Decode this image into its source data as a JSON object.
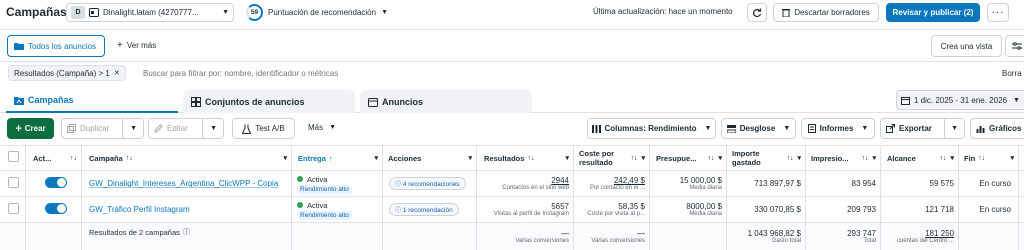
{
  "header": {
    "title": "Campañas",
    "account_initial": "D",
    "account_name": "Dinalight.latam (4270777...",
    "score_value": "59",
    "score_label": "Puntuación de recomendación",
    "last_update": "Última actualización: hace un momento",
    "discard_label": "Descartar borradores",
    "publish_label": "Revisar y publicar (2)",
    "more_label": "···"
  },
  "filterbar": {
    "all_ads_label": "Todos los anuncios",
    "see_more_label": "Ver más",
    "create_view_label": "Crea una vista"
  },
  "searchbar": {
    "chip_label": "Resultados (Campaña) > 1",
    "chip_close": "✕",
    "placeholder": "Buscar para filtrar por: nombre, identificador o métricas",
    "right_label": "Borra"
  },
  "tabs": {
    "campaigns": "Campañas",
    "adsets": "Conjuntos de anuncios",
    "ads": "Anuncios",
    "date_range": "1 dic. 2025 - 31 ene. 2026"
  },
  "toolbar": {
    "create": "Crear",
    "duplicate": "Duplicar",
    "edit": "Editar",
    "abtest": "Test A/B",
    "more": "Más",
    "columns": "Columnas: Rendimiento",
    "breakdown": "Desglose",
    "reports": "Informes",
    "export": "Exportar",
    "charts": "Gráficos"
  },
  "table": {
    "headers": {
      "active": "Act...",
      "campaign": "Campaña",
      "delivery": "Entrega",
      "actions": "Acciones",
      "results": "Resultados",
      "cost_line1": "Coste por",
      "cost_line2": "resultado",
      "budget": "Presupue...",
      "spent_line1": "Importe",
      "spent_line2": "gastado",
      "impressions": "Impresio...",
      "reach": "Alcance",
      "end": "Fin",
      "sort_arrow": "↑",
      "sort_both": "↑↓",
      "menu": "▾"
    },
    "rows": [
      {
        "name": "GW_Dinalight_Intereses_Argentina_ClicWPP - Copia",
        "delivery": "Activa",
        "delivery_badge": "Rendimiento alto",
        "actions": "4 recomendaciones",
        "results": "2944",
        "results_sub": "Contactos en el sitio web",
        "cost": "242,49 $",
        "cost_sub": "Por contacto en el ...",
        "budget": "15 000,00 $",
        "budget_sub": "Media diaria",
        "spent": "713 897,97 $",
        "impressions": "83 954",
        "reach": "59 575",
        "end": "En curso"
      },
      {
        "name": "GW_Tráfico Perfil Instagram",
        "delivery": "Activa",
        "delivery_badge": "Rendimiento alto",
        "actions": "1 recomendación",
        "results": "5657",
        "results_sub": "Visitas al perfil de Instagram",
        "cost": "58,35 $",
        "cost_sub": "Coste por visita al p...",
        "budget": "8000,00 $",
        "budget_sub": "Media diaria",
        "spent": "330 070,85 $",
        "impressions": "209 793",
        "reach": "121 718",
        "end": "En curso"
      }
    ],
    "summary": {
      "label": "Resultados de 2 campañas",
      "results": "—",
      "results_sub": "Varias conversiones",
      "cost": "—",
      "cost_sub": "Varias conversiones",
      "spent": "1 043 968,82 $",
      "spent_sub": "Gasto total",
      "impressions": "293 747",
      "impressions_sub": "Total",
      "reach": "181 250",
      "reach_sub": "cuentas del Centro ..."
    }
  },
  "colors": {
    "accent": "#0a78be",
    "create_green": "#0d6e3f",
    "active_dot": "#31a24c"
  }
}
